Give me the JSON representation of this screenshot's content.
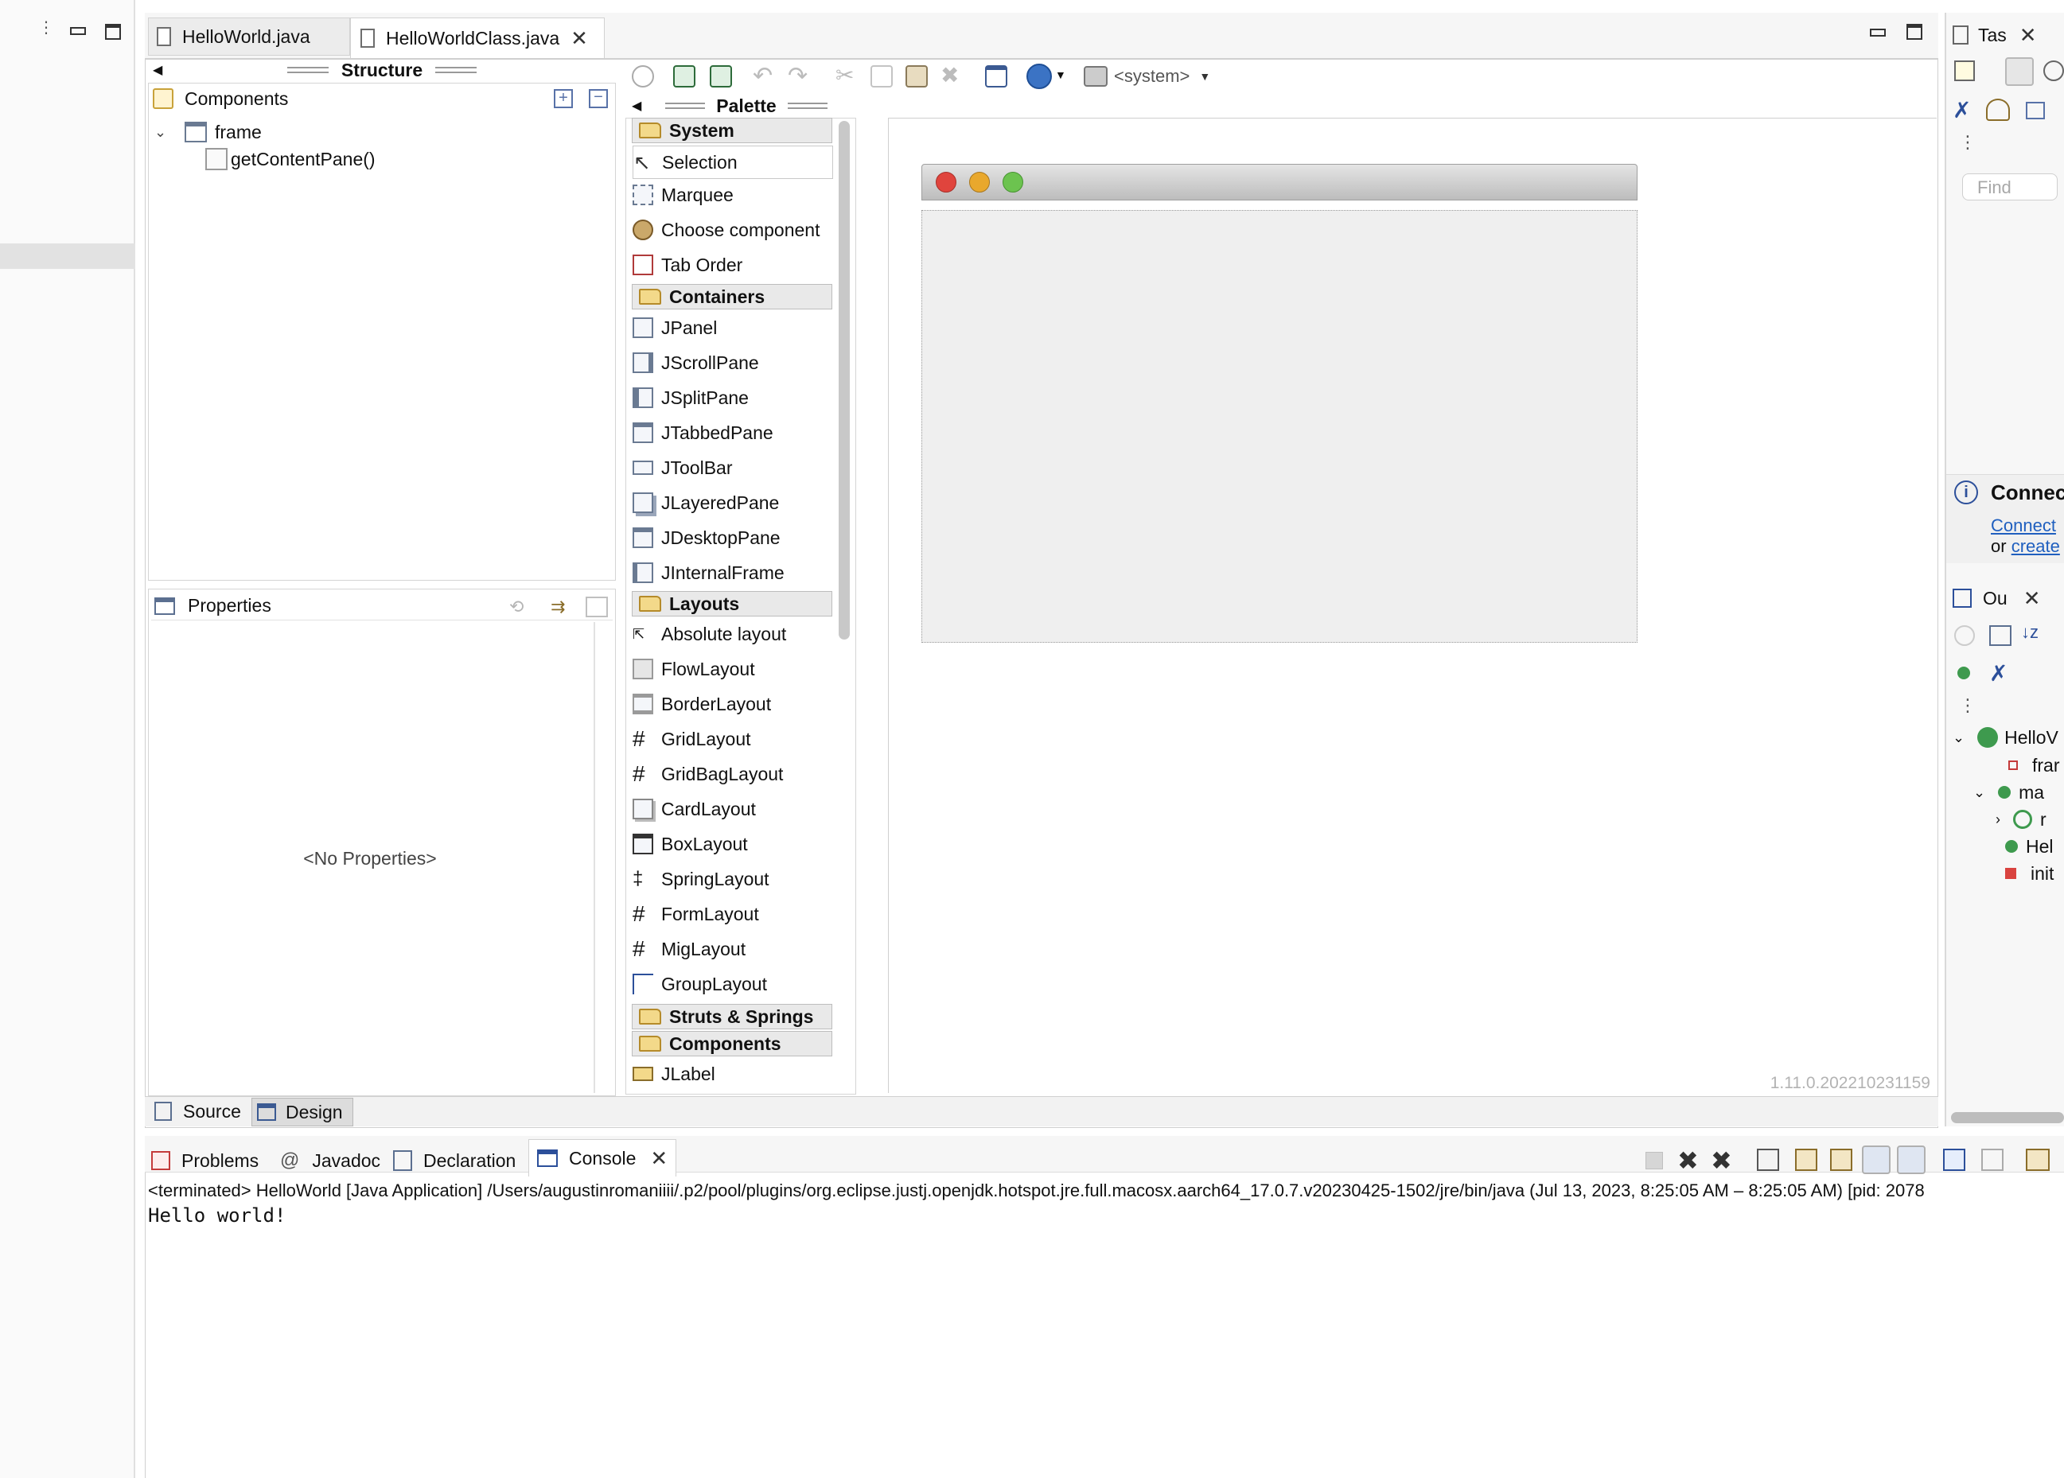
{
  "editor_tabs": [
    {
      "label": "HelloWorld.java",
      "active": false
    },
    {
      "label": "HelloWorldClass.java",
      "active": true
    }
  ],
  "structure": {
    "title": "Structure",
    "components_label": "Components",
    "tree": [
      {
        "label": "frame",
        "level": 0
      },
      {
        "label": "getContentPane()",
        "level": 1
      }
    ]
  },
  "properties": {
    "title": "Properties",
    "empty_text": "<No Properties>"
  },
  "toolbar": {
    "system_combo": "<system>"
  },
  "palette": {
    "title": "Palette",
    "categories": [
      {
        "name": "System",
        "items": [
          "Selection",
          "Marquee",
          "Choose component",
          "Tab Order"
        ]
      },
      {
        "name": "Containers",
        "items": [
          "JPanel",
          "JScrollPane",
          "JSplitPane",
          "JTabbedPane",
          "JToolBar",
          "JLayeredPane",
          "JDesktopPane",
          "JInternalFrame"
        ]
      },
      {
        "name": "Layouts",
        "items": [
          "Absolute layout",
          "FlowLayout",
          "BorderLayout",
          "GridLayout",
          "GridBagLayout",
          "CardLayout",
          "BoxLayout",
          "SpringLayout",
          "FormLayout",
          "MigLayout",
          "GroupLayout"
        ]
      },
      {
        "name": "Struts & Springs",
        "items": []
      },
      {
        "name": "Components",
        "items": [
          "JLabel"
        ]
      }
    ]
  },
  "design": {
    "version": "1.11.0.202210231159"
  },
  "bottom_tabs": [
    {
      "label": "Source",
      "active": false
    },
    {
      "label": "Design",
      "active": true
    }
  ],
  "console_tabs": [
    {
      "label": "Problems"
    },
    {
      "label": "Javadoc"
    },
    {
      "label": "Declaration"
    },
    {
      "label": "Console",
      "active": true
    }
  ],
  "console": {
    "header": "<terminated> HelloWorld [Java Application] /Users/augustinromaniiii/.p2/pool/plugins/org.eclipse.justj.openjdk.hotspot.jre.full.macosx.aarch64_17.0.7.v20230425-1502/jre/bin/java  (Jul 13, 2023, 8:25:05 AM – 8:25:05 AM) [pid: 2078",
    "output": "Hello world!"
  },
  "right_panel": {
    "tasks_tab": "Tas",
    "find_placeholder": "Find",
    "connect_title": "Connec",
    "connect_link": "Connect",
    "or_text": "or",
    "create_link": "create",
    "outline_tab": "Ou",
    "outline_items": [
      "HelloV",
      "frar",
      "ma",
      "r",
      "Hel",
      "init"
    ]
  }
}
